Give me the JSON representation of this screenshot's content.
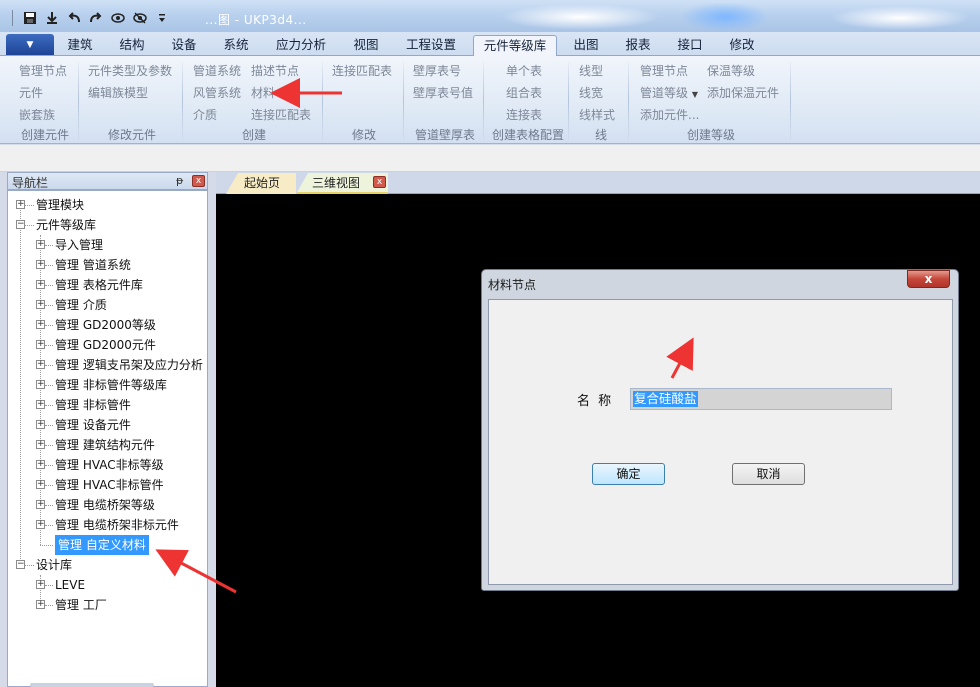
{
  "window": {
    "title": "...图 - UKP3d4..."
  },
  "qat": {
    "icons": [
      "save-icon",
      "download-icon",
      "undo-icon",
      "redo-icon",
      "eye-icon",
      "eye-off-icon",
      "customize-icon"
    ]
  },
  "ribbon_tabs": [
    {
      "label": "建筑"
    },
    {
      "label": "结构"
    },
    {
      "label": "设备"
    },
    {
      "label": "系统"
    },
    {
      "label": "应力分析"
    },
    {
      "label": "视图"
    },
    {
      "label": "工程设置"
    },
    {
      "label": "元件等级库"
    },
    {
      "label": "出图"
    },
    {
      "label": "报表"
    },
    {
      "label": "接口"
    },
    {
      "label": "修改"
    }
  ],
  "ribbon": {
    "g1": {
      "items": [
        "管理节点",
        "元件",
        "嵌套族"
      ],
      "group": "创建元件"
    },
    "g2": {
      "items": [
        "元件类型及参数",
        "编辑族模型"
      ],
      "group": "修改元件"
    },
    "g3": {
      "items": [
        "管道系统",
        "描述节点",
        "风管系统",
        "材料",
        "介质",
        "连接匹配表"
      ],
      "group": "创建"
    },
    "g4": {
      "items": [
        "连接匹配表"
      ],
      "group": "修改"
    },
    "g5": {
      "items": [
        "壁厚表号",
        "壁厚表号值"
      ],
      "group": "管道壁厚表"
    },
    "g6": {
      "items": [
        "单个表",
        "组合表",
        "连接表"
      ],
      "group": "创建表格配置"
    },
    "g7": {
      "items": [
        "线型",
        "线宽",
        "线样式"
      ],
      "group": "线"
    },
    "g8": {
      "items": [
        "管理节点",
        "保温等级",
        "管道等级",
        "添加保温元件",
        "添加元件..."
      ],
      "group": "创建等级"
    }
  },
  "nav": {
    "title": "导航栏",
    "pin": "ᵽ",
    "close": "x",
    "tree": [
      {
        "label": "管理模块",
        "level": 0,
        "expander": "+"
      },
      {
        "label": "元件等级库",
        "level": 0,
        "expander": "−"
      },
      {
        "label": "导入管理",
        "level": 1,
        "expander": "+"
      },
      {
        "label": "管理 管道系统",
        "level": 1,
        "expander": "+"
      },
      {
        "label": "管理 表格元件库",
        "level": 1,
        "expander": "+"
      },
      {
        "label": "管理 介质",
        "level": 1,
        "expander": "+"
      },
      {
        "label": "管理 GD2000等级",
        "level": 1,
        "expander": "+"
      },
      {
        "label": "管理 GD2000元件",
        "level": 1,
        "expander": "+"
      },
      {
        "label": "管理 逻辑支吊架及应力分析",
        "level": 1,
        "expander": "+"
      },
      {
        "label": "管理 非标管件等级库",
        "level": 1,
        "expander": "+"
      },
      {
        "label": "管理 非标管件",
        "level": 1,
        "expander": "+"
      },
      {
        "label": "管理 设备元件",
        "level": 1,
        "expander": "+"
      },
      {
        "label": "管理 建筑结构元件",
        "level": 1,
        "expander": "+"
      },
      {
        "label": "管理 HVAC非标等级",
        "level": 1,
        "expander": "+"
      },
      {
        "label": "管理 HVAC非标管件",
        "level": 1,
        "expander": "+"
      },
      {
        "label": "管理 电缆桥架等级",
        "level": 1,
        "expander": "+"
      },
      {
        "label": "管理 电缆桥架非标元件",
        "level": 1,
        "expander": "+"
      },
      {
        "label": "管理 自定义材料",
        "level": 1,
        "expander": "",
        "selected": true
      },
      {
        "label": "设计库",
        "level": 0,
        "expander": "−"
      },
      {
        "label": "LEVE",
        "level": 1,
        "expander": "+"
      },
      {
        "label": "管理 工厂",
        "level": 1,
        "expander": "+"
      }
    ]
  },
  "doc_tabs": [
    {
      "label": "起始页"
    },
    {
      "label": "三维视图"
    }
  ],
  "doc_tab_close": "x",
  "dialog": {
    "title": "材料节点",
    "close": "x",
    "name_label": "名 称",
    "name_value": "复合硅酸盐",
    "ok": "确定",
    "cancel": "取消"
  },
  "colors": {
    "selection": "#3399ff",
    "annotation_arrow": "#ee3333",
    "viewport": "#000000"
  }
}
